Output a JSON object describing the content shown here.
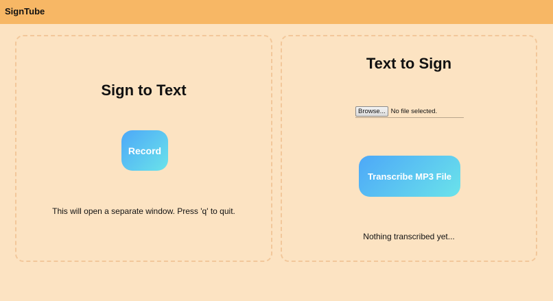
{
  "header": {
    "brand": "SignTube"
  },
  "sign_to_text": {
    "title": "Sign to Text",
    "record_label": "Record",
    "note": "This will open a separate window. Press 'q' to quit."
  },
  "text_to_sign": {
    "title": "Text to Sign",
    "browse_label": "Browse...",
    "file_status": "No file selected.",
    "transcribe_label": "Transcribe MP3 File",
    "result_text": "Nothing transcribed yet..."
  },
  "colors": {
    "header_bg": "#f7b765",
    "page_bg": "#fce3c2",
    "button_gradient_start": "#4da8f8",
    "button_gradient_end": "#6ae3ea"
  }
}
